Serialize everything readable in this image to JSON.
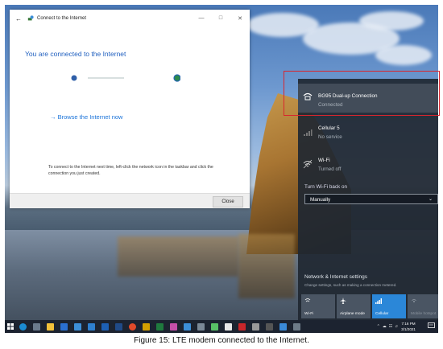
{
  "window": {
    "title": "Connect to the Internet",
    "heading": "You are connected to the Internet",
    "browse_link": "Browse the Internet now",
    "info_text": "To connect to the Internet next time, left-click the network icon in the taskbar and click the connection you just created.",
    "close_label": "Close"
  },
  "flyout": {
    "connections": [
      {
        "name": "BG95 Dual-up Connection",
        "status": "Connected"
      },
      {
        "name": "Cellular 5",
        "status": "No service"
      },
      {
        "name": "Wi-Fi",
        "status": "Turned off"
      }
    ],
    "wifi_back_label": "Turn Wi-Fi back on",
    "wifi_back_value": "Manually",
    "settings_title": "Network & Internet settings",
    "settings_sub": "Change settings, such as making a connection metered.",
    "tiles": [
      {
        "label": "Wi-Fi",
        "state": "off"
      },
      {
        "label": "Airplane mode",
        "state": "off"
      },
      {
        "label": "Cellular",
        "state": "on"
      },
      {
        "label": "Mobile hotspot",
        "state": "disabled"
      }
    ]
  },
  "taskbar": {
    "time": "7:16 PM",
    "date": "3/1/2021"
  },
  "caption": "Figure 15: LTE modem connected to the Internet.",
  "colors": {
    "accent": "#2b87d8",
    "highlight_box": "#d8262e",
    "heading_blue": "#1f5fbf"
  }
}
